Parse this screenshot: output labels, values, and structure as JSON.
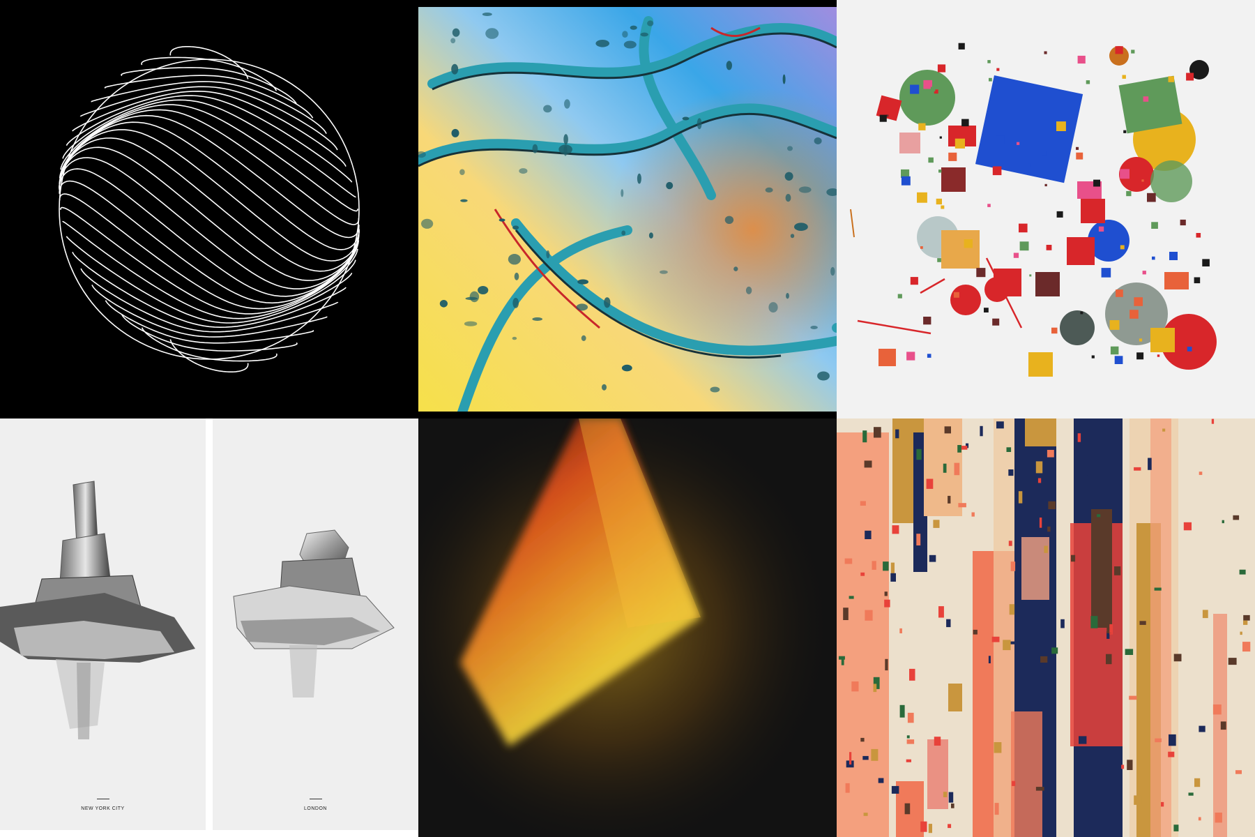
{
  "gallery": {
    "tiles": [
      {
        "subject": "wireframe-sphere",
        "background": "#000000",
        "line_color": "#ffffff"
      },
      {
        "subject": "liquid-abstract",
        "colors": [
          "#2bb4e6",
          "#f6d23c",
          "#e88a3a",
          "#a28de0",
          "#2a9eb0"
        ]
      },
      {
        "subject": "geometric-composition",
        "background": "#f2f2f2",
        "colors": [
          "#1f4fd0",
          "#d8262a",
          "#5f9a5a",
          "#e8b21e",
          "#6b2a2a"
        ]
      },
      {
        "subject": "city-posters",
        "background": "#efefef",
        "posters": [
          {
            "label": "NEW YORK CITY"
          },
          {
            "label": "LONDON"
          }
        ]
      },
      {
        "subject": "light-prism",
        "background": "#121212",
        "colors": [
          "#e4541c",
          "#f2c426"
        ]
      },
      {
        "subject": "vertical-blocks",
        "background": "#ece0cc",
        "colors": [
          "#f07a5a",
          "#1c2a5a",
          "#c9963e",
          "#e8423a"
        ]
      }
    ]
  }
}
